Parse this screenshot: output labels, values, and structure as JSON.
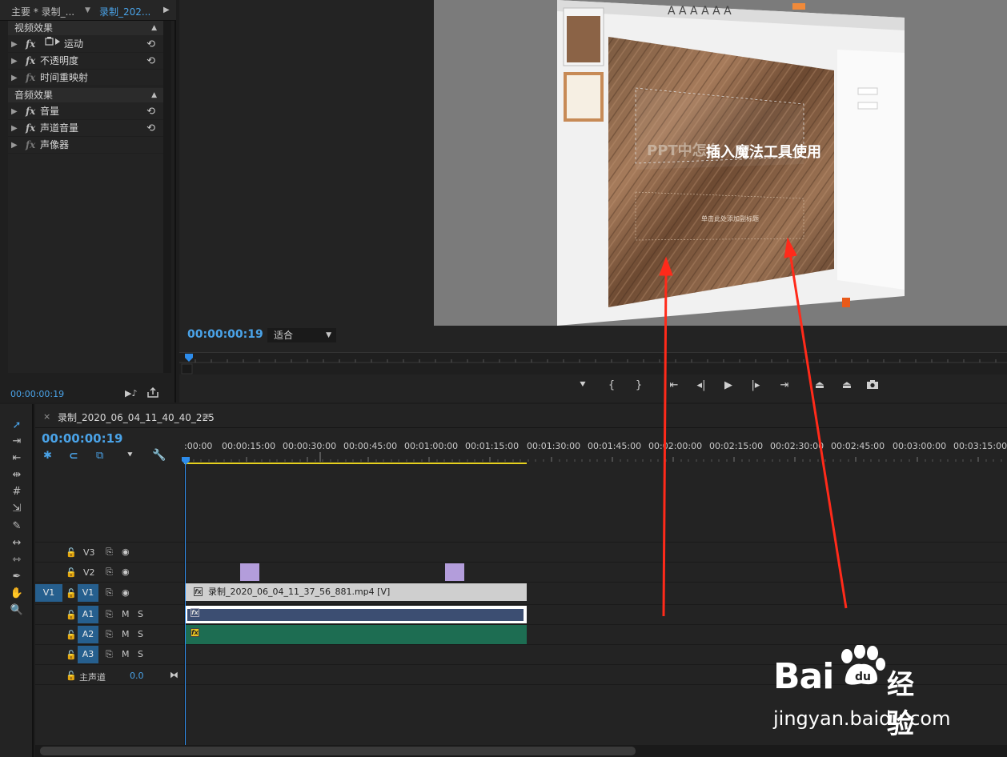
{
  "effect_controls": {
    "tab_main": "主要 * 录制_...",
    "tab_seq": "录制_202...",
    "video_section": "视频效果",
    "audio_section": "音频效果",
    "video_effects": [
      {
        "name": "运动",
        "fx_active": true,
        "has_reset": true
      },
      {
        "name": "不透明度",
        "fx_active": true,
        "has_reset": true
      },
      {
        "name": "时间重映射",
        "fx_active": false,
        "has_reset": false
      }
    ],
    "audio_effects": [
      {
        "name": "音量",
        "fx_active": true,
        "has_reset": true
      },
      {
        "name": "声道音量",
        "fx_active": true,
        "has_reset": true
      },
      {
        "name": "声像器",
        "fx_active": false,
        "has_reset": false
      }
    ],
    "fx_symbol": "fx",
    "timecode": "00:00:00:19"
  },
  "program_monitor": {
    "timecode": "00:00:00:19",
    "zoom": "适合",
    "slide_title_left": "PPT中怎么",
    "slide_title_right": "插入魔法工具使用",
    "slide_subtitle": "单击此处添加副标题"
  },
  "timeline": {
    "sequence_name": "录制_2020_06_04_11_40_40_225",
    "close_glyph": "×",
    "menu_glyph": "≡",
    "timecode": "00:00:00:19",
    "ruler_labels": [
      ":00:00",
      "00:00:15:00",
      "00:00:30:00",
      "00:00:45:00",
      "00:01:00:00",
      "00:01:15:00",
      "00:01:30:00",
      "00:01:45:00",
      "00:02:00:00",
      "00:02:15:00",
      "00:02:30:00",
      "00:02:45:00",
      "00:03:00:00",
      "00:03:15:00"
    ],
    "tracks": {
      "v3": "V3",
      "v2": "V2",
      "v1": "V1",
      "v1_source": "V1",
      "a1": "A1",
      "a2": "A2",
      "a3": "A3",
      "master_label": "主声道",
      "master_value": "0.0",
      "mute": "M",
      "solo": "S"
    },
    "video_clip_name": "录制_2020_06_04_11_37_56_881.mp4 [V]"
  },
  "watermark": {
    "brand": "Bai",
    "brand_suffix": "经验",
    "url": "jingyan.baidu.com"
  },
  "colors": {
    "accent_blue": "#4aa3e8",
    "track_selected": "#265f8e",
    "audio_clip_a1": "#3c4e72",
    "audio_clip_a2": "#1d6d52",
    "marker_purple": "#b39ddb",
    "annotation_red": "#ff2a1a"
  }
}
